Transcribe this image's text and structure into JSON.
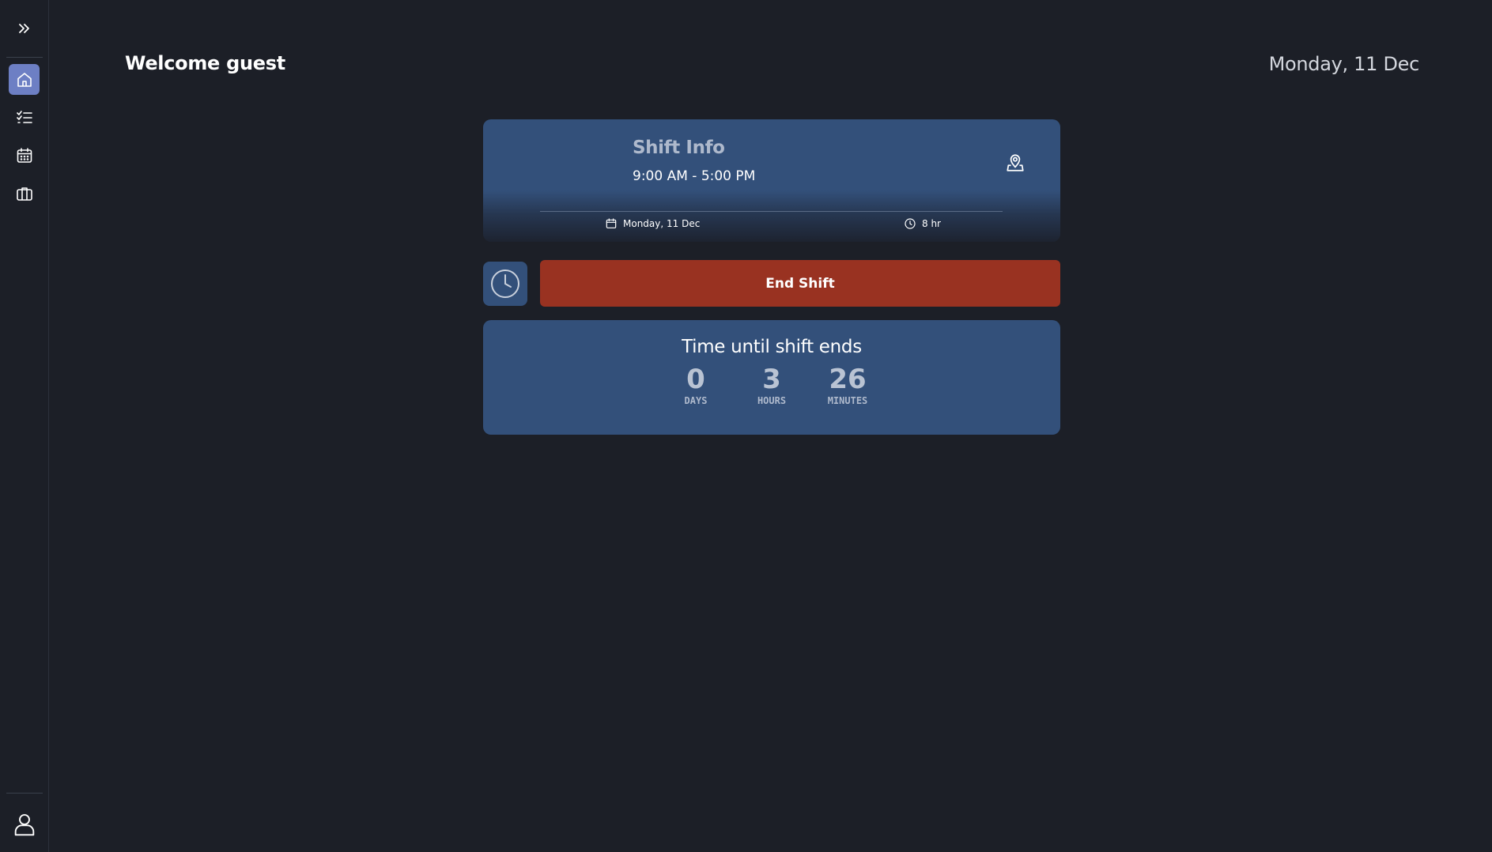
{
  "header": {
    "welcome": "Welcome guest",
    "date": "Monday, 11 Dec"
  },
  "sidebar": {
    "items": [
      {
        "icon": "chevrons-right-icon",
        "label": "Expand sidebar"
      },
      {
        "icon": "home-icon",
        "label": "Home",
        "active": true
      },
      {
        "icon": "checklist-icon",
        "label": "Tasks"
      },
      {
        "icon": "calendar-icon",
        "label": "Calendar"
      },
      {
        "icon": "briefcase-icon",
        "label": "Jobs"
      }
    ],
    "profile_icon": "user-icon"
  },
  "shift": {
    "title": "Shift Info",
    "time_range": "9:00 AM - 5:00 PM",
    "date": "Monday, 11 Dec",
    "duration": "8 hr",
    "location_icon": "location-user-icon"
  },
  "actions": {
    "end_shift_label": "End Shift",
    "clock_icon": "clock-icon"
  },
  "countdown": {
    "title": "Time until shift ends",
    "days": {
      "value": "0",
      "label": "DAYS"
    },
    "hours": {
      "value": "3",
      "label": "HOURS"
    },
    "minutes": {
      "value": "26",
      "label": "MINUTES"
    }
  },
  "colors": {
    "background": "#1c1f27",
    "card": "#33507a",
    "active_nav": "#6d7fc4",
    "end_shift": "#993221"
  }
}
